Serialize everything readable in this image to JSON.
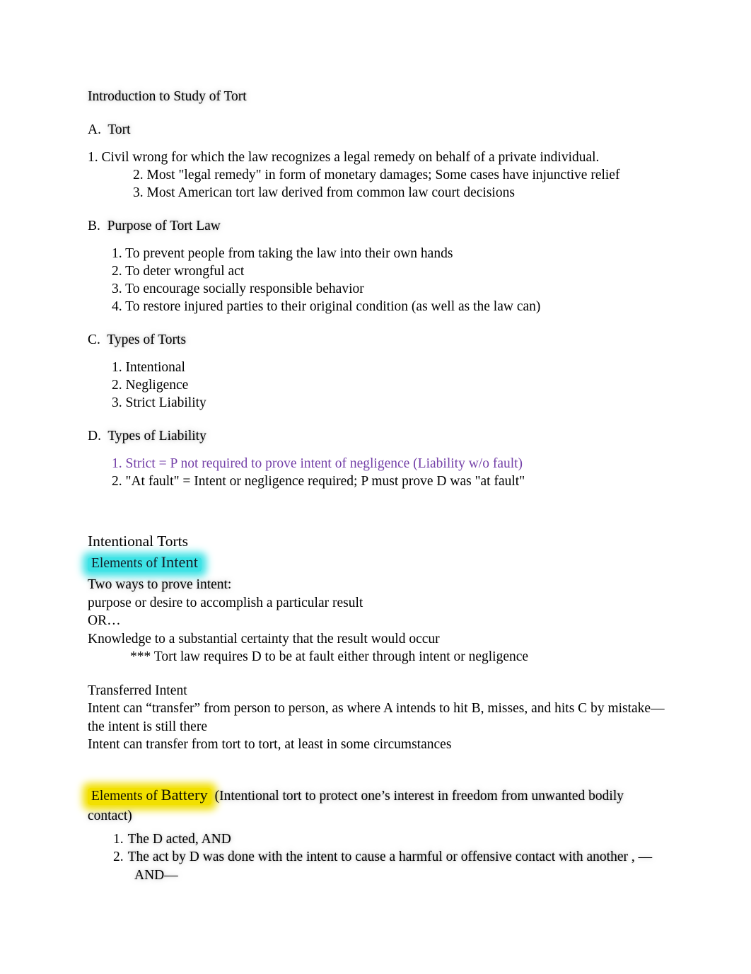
{
  "document": {
    "title": "Introduction to Study of Tort",
    "colors": {
      "text": "#000000",
      "purple_accent": "#7440a8",
      "cyan_highlight": "#3ee3e6",
      "yellow_highlight": "#f2e000"
    },
    "sections": [
      {
        "letter": "A.",
        "heading": "Tort",
        "items": [
          "1.  Civil wrong for which the law recognizes a legal remedy on behalf of a private individual.",
          "2.  Most \"legal remedy\" in form of monetary damages;  Some cases have injunctive relief",
          "3.  Most American tort law derived from common law court decisions"
        ]
      },
      {
        "letter": "B.",
        "heading": "Purpose of Tort Law",
        "items": [
          "1.  To prevent people from taking the law into their own hands",
          "2.  To deter wrongful act",
          "3.  To encourage socially responsible behavior",
          "4.  To restore injured parties to their original condition (as well as the law can)"
        ]
      },
      {
        "letter": "C.",
        "heading": "Types of Torts",
        "items": [
          "1.  Intentional",
          "2.  Negligence",
          "3.  Strict Liability"
        ]
      },
      {
        "letter": "D.",
        "heading": "Types of Liability",
        "items": [
          "1.  Strict  = P not required to prove intent of negligence (Liability w/o fault)",
          "2.  \"At fault\"   = Intent or negligence required;  P must prove D was \"at fault\""
        ]
      }
    ],
    "intentional_torts": {
      "heading": "Intentional Torts",
      "intent_highlight": {
        "prefix": "Elements of ",
        "emphasis": "Intent"
      },
      "lines": [
        "Two ways to prove intent:",
        "purpose or desire   to accomplish a particular result",
        "OR…",
        "Knowledge to a substantial certainty   that the result would occur"
      ],
      "note": "*** Tort law requires D to be at fault either through intent or negligence"
    },
    "transferred_intent": {
      "heading": "Transferred Intent",
      "lines": [
        "Intent can “transfer” from person to person, as where A intends to hit B, misses, and hits C by mistake—the intent is still there",
        "Intent can transfer from tort to tort, at least in some circumstances"
      ]
    },
    "battery": {
      "highlight": {
        "prefix": "Elements of ",
        "emphasis": "Battery"
      },
      "parenthetical": " (Intentional tort to protect one’s interest in freedom from unwanted bodily contact)",
      "items": [
        {
          "num": "1.",
          "text": "The D acted, AND"
        },
        {
          "num": "2.",
          "text": "The act by D was done with the intent  to cause a harmful or offensive contact with another , —AND—"
        }
      ]
    }
  }
}
